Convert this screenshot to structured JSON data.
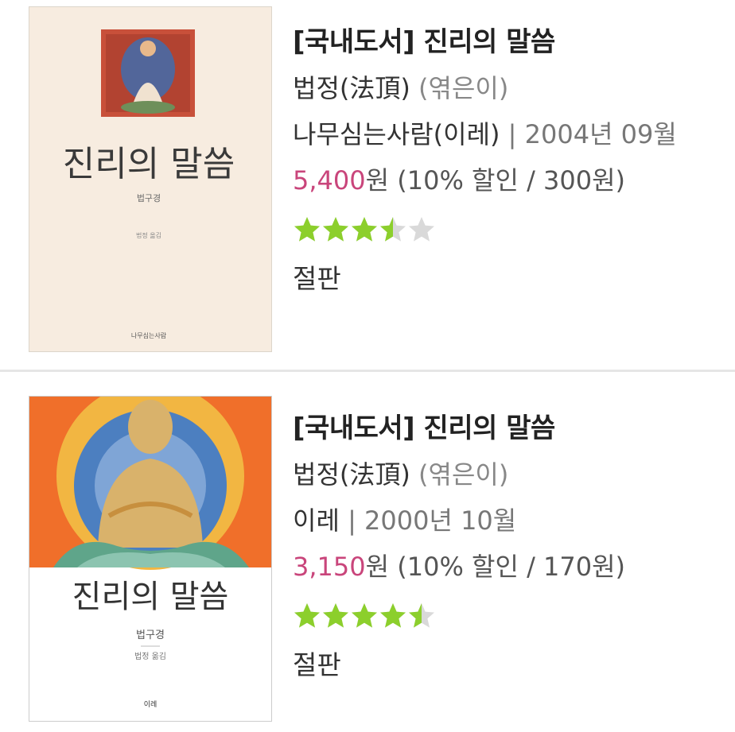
{
  "results": [
    {
      "title": "[국내도서] 진리의 말씀",
      "author": "법정(法頂)",
      "author_role": "(엮은이)",
      "publisher": "나무심는사람(이레)",
      "date": "2004년 09월",
      "price": "5,400",
      "price_unit": "원",
      "discount": "(10% 할인 / 300원)",
      "rating": 3.5,
      "status": "절판",
      "cover_title": "진리의 말씀",
      "cover_subtitle": "법구경",
      "cover_author": "법정 옮김",
      "cover_publisher": "나무심는사람"
    },
    {
      "title": "[국내도서] 진리의 말씀",
      "author": "법정(法頂)",
      "author_role": "(엮은이)",
      "publisher": "이레",
      "date": "2000년 10월",
      "price": "3,150",
      "price_unit": "원",
      "discount": "(10% 할인 / 170원)",
      "rating": 4.5,
      "status": "절판",
      "cover_title": "진리의 말씀",
      "cover_subtitle": "법구경",
      "cover_author": "법정 옮김",
      "cover_publisher": "이레"
    }
  ],
  "colors": {
    "price": "#c9457b",
    "star_filled": "#8ccf2c",
    "star_empty": "#d9d9d9"
  },
  "icons": {
    "star": "star-icon"
  }
}
